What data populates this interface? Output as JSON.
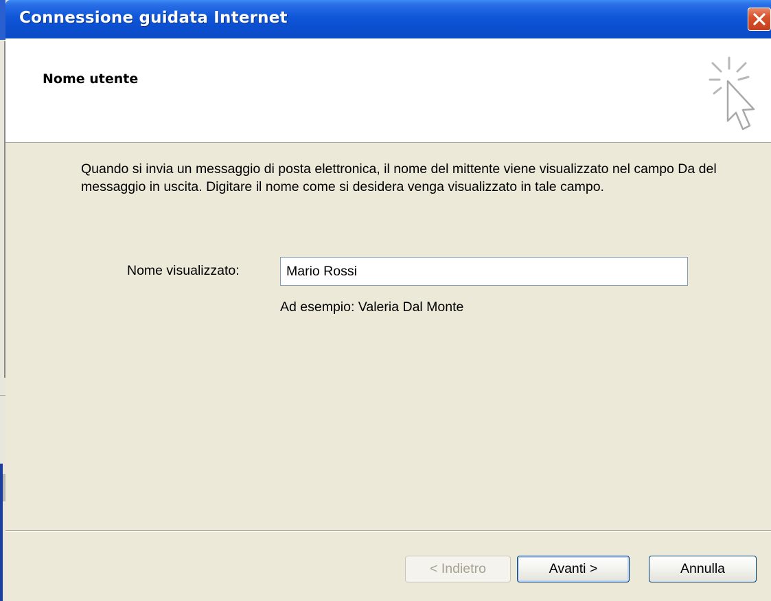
{
  "window": {
    "title": "Connessione guidata Internet",
    "close_icon": "close-icon"
  },
  "header": {
    "title": "Nome utente",
    "icon": "wizard-cursor-sparkle-icon"
  },
  "body": {
    "description": "Quando si invia un messaggio di posta elettronica, il nome del mittente viene visualizzato nel campo Da del messaggio in uscita. Digitare il nome come si desidera venga visualizzato in tale campo.",
    "display_name_label": "Nome visualizzato:",
    "display_name_value": "Mario Rossi",
    "example": "Ad esempio: Valeria Dal Monte"
  },
  "buttons": {
    "back": "< Indietro",
    "next": "Avanti >",
    "cancel": "Annulla"
  },
  "colors": {
    "titlebar": "#0b4fd0",
    "dialog_bg": "#ece9d8",
    "header_bg": "#ffffff",
    "close_button": "#d8512d",
    "input_border": "#7f9db9"
  }
}
